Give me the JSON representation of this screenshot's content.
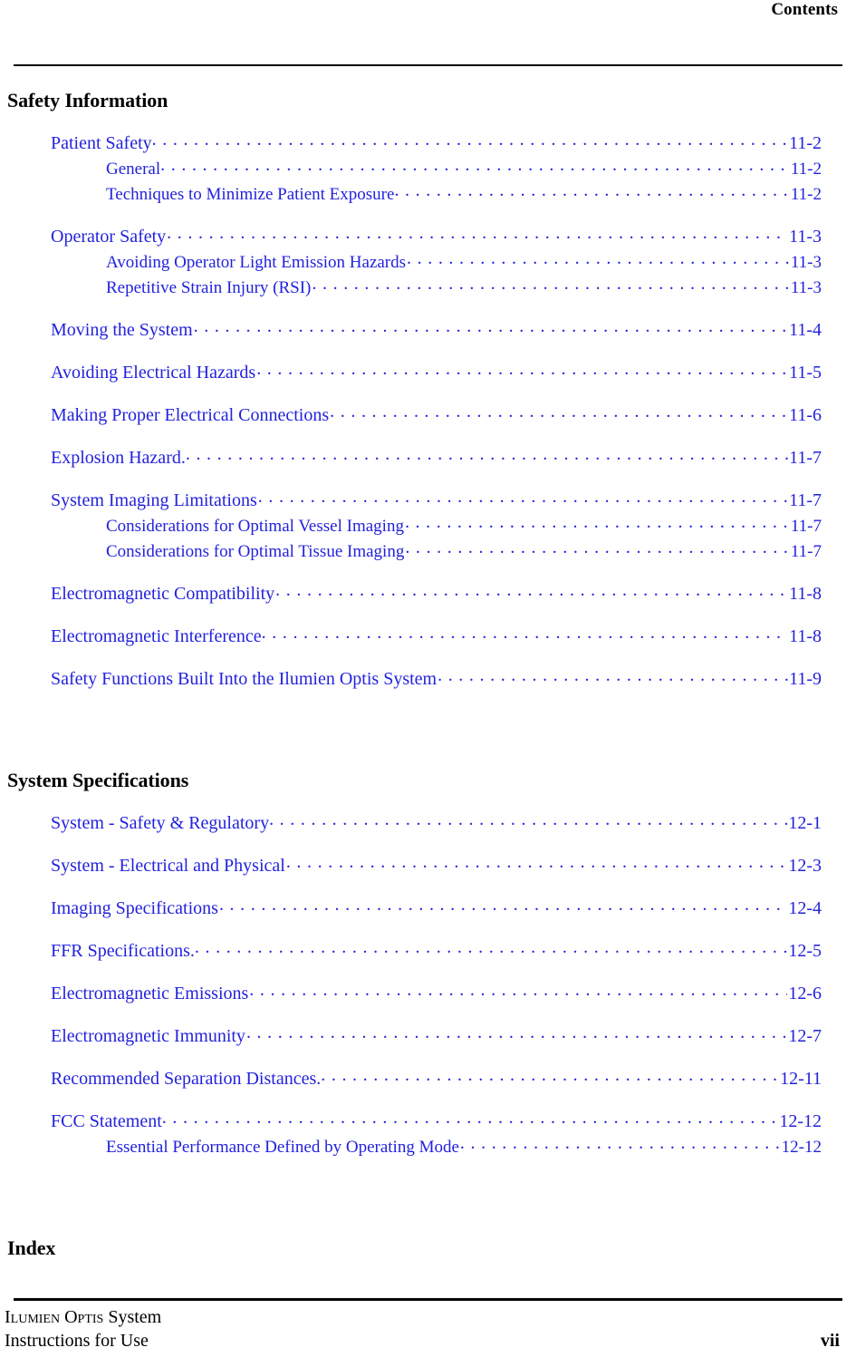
{
  "header": {
    "title": "Contents"
  },
  "sections": [
    {
      "title": "Safety Information",
      "groups": [
        {
          "entries": [
            {
              "label": "Patient Safety",
              "page": "11-2",
              "level": 1,
              "tight": true
            },
            {
              "label": "General",
              "page": "11-2",
              "level": 2,
              "tight": true
            },
            {
              "label": "Techniques to Minimize Patient Exposure",
              "page": "11-2",
              "level": 2,
              "tight": true
            }
          ]
        },
        {
          "entries": [
            {
              "label": "Operator Safety",
              "page": "11-3",
              "level": 1,
              "tight": false
            },
            {
              "label": "Avoiding Operator Light Emission Hazards",
              "page": "11-3",
              "level": 2,
              "tight": false
            },
            {
              "label": "Repetitive Strain Injury (RSI)",
              "page": "11-3",
              "level": 2,
              "tight": false
            }
          ]
        },
        {
          "entries": [
            {
              "label": "Moving the System",
              "page": "11-4",
              "level": 1,
              "tight": false
            }
          ]
        },
        {
          "entries": [
            {
              "label": "Avoiding Electrical Hazards",
              "page": "11-5",
              "level": 1,
              "tight": false
            }
          ]
        },
        {
          "entries": [
            {
              "label": "Making Proper Electrical Connections",
              "page": "11-6",
              "level": 1,
              "tight": false
            }
          ]
        },
        {
          "entries": [
            {
              "label": "Explosion Hazard.",
              "page": "11-7",
              "level": 1,
              "tight": true
            }
          ]
        },
        {
          "entries": [
            {
              "label": "System Imaging Limitations",
              "page": "11-7",
              "level": 1,
              "tight": false
            },
            {
              "label": "Considerations for Optimal Vessel Imaging",
              "page": "11-7",
              "level": 2,
              "tight": false
            },
            {
              "label": "Considerations for Optimal Tissue Imaging",
              "page": "11-7",
              "level": 2,
              "tight": false
            }
          ]
        },
        {
          "entries": [
            {
              "label": "Electromagnetic Compatibility",
              "page": "11-8",
              "level": 1,
              "tight": false
            }
          ]
        },
        {
          "entries": [
            {
              "label": "Electromagnetic Interference",
              "page": "11-8",
              "level": 1,
              "tight": true
            }
          ]
        },
        {
          "entries": [
            {
              "label": "Safety Functions Built Into the Ilumien Optis System",
              "page": "11-9",
              "level": 1,
              "tight": false
            }
          ]
        }
      ]
    },
    {
      "title": "System Specifications",
      "groups": [
        {
          "entries": [
            {
              "label": "System - Safety & Regulatory",
              "page": "12-1",
              "level": 1,
              "tight": true
            }
          ]
        },
        {
          "entries": [
            {
              "label": "System - Electrical and Physical",
              "page": "12-3",
              "level": 1,
              "tight": false
            }
          ]
        },
        {
          "entries": [
            {
              "label": "Imaging Specifications",
              "page": "12-4",
              "level": 1,
              "tight": false
            }
          ]
        },
        {
          "entries": [
            {
              "label": "FFR Specifications.",
              "page": "12-5",
              "level": 1,
              "tight": true
            }
          ]
        },
        {
          "entries": [
            {
              "label": "Electromagnetic Emissions",
              "page": "12-6",
              "level": 1,
              "tight": false
            }
          ]
        },
        {
          "entries": [
            {
              "label": "Electromagnetic Immunity",
              "page": "12-7",
              "level": 1,
              "tight": false
            }
          ]
        },
        {
          "entries": [
            {
              "label": "Recommended Separation Distances.",
              "page": "12-11",
              "level": 1,
              "tight": true
            }
          ]
        },
        {
          "entries": [
            {
              "label": "FCC Statement",
              "page": "12-12",
              "level": 1,
              "tight": true
            },
            {
              "label": "Essential Performance Defined by Operating Mode",
              "page": "12-12",
              "level": 2,
              "tight": false
            }
          ]
        }
      ]
    },
    {
      "title": "Index",
      "groups": []
    }
  ],
  "footer": {
    "line_1_smallcaps_a": "Ilumien",
    "line_1_smallcaps_b": "Optis",
    "line_1_rest": "System",
    "line_2": "Instructions for Use",
    "page_number": "vii"
  },
  "colors": {
    "link_blue": "#2222dd",
    "text_black": "#000000",
    "page_background": "#ffffff"
  }
}
